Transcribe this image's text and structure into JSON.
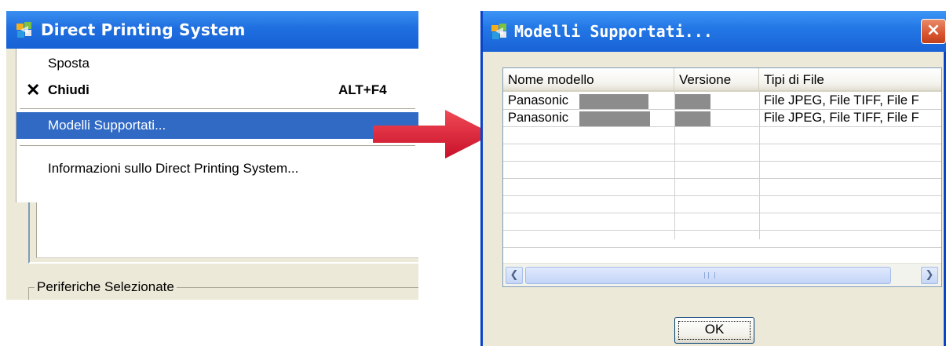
{
  "left_window": {
    "title": "Direct Printing System",
    "menu": {
      "items": [
        {
          "label": "Sposta"
        },
        {
          "label": "Chiudi",
          "shortcut": "ALT+F4",
          "icon": "close-x-icon"
        },
        {
          "label": "Modelli Supportati...",
          "highlighted": true
        },
        {
          "label": "Informazioni sullo Direct Printing System..."
        }
      ]
    },
    "groupbox_label": "Periferiche Selezionate"
  },
  "dialog": {
    "title": "Modelli Supportati...",
    "close_label": "×",
    "columns": [
      "Nome modello",
      "Versione",
      "Tipi di File"
    ],
    "rows": [
      {
        "model": "Panasonic",
        "version": "",
        "file_types": "File JPEG, File TIFF, File F"
      },
      {
        "model": "Panasonic",
        "version": "",
        "file_types": "File JPEG, File TIFF, File F"
      }
    ],
    "ok_label": "OK"
  },
  "colors": {
    "titlebar_blue": "#1f6fe0",
    "menu_highlight": "#316ac5",
    "arrow_red": "#e0262e",
    "dialog_bg": "#ece9d8"
  }
}
